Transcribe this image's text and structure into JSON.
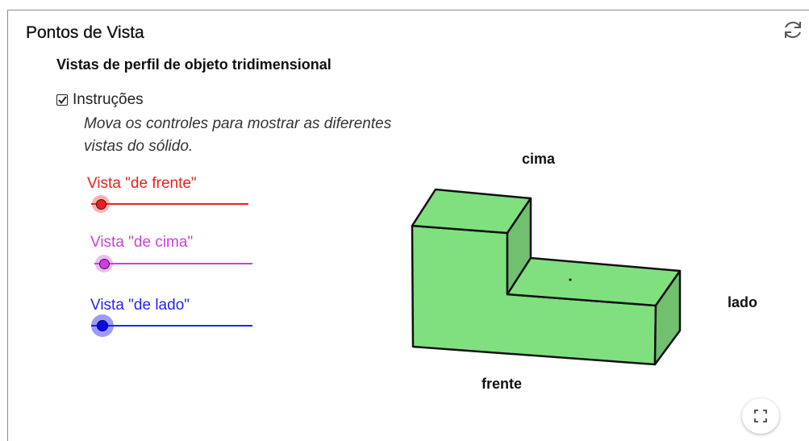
{
  "app": {
    "title": "Pontos de Vista",
    "subtitle": "Vistas de perfil de objeto tridimensional"
  },
  "toolbar": {
    "reset_icon": "refresh-icon",
    "fullscreen_icon": "fullscreen-icon"
  },
  "instructions": {
    "checkbox_label": "Instruções",
    "checked": true,
    "text_line1": "Mova os controles para mostrar as diferentes",
    "text_line2": "vistas do sólido."
  },
  "sliders": [
    {
      "label": "Vista \"de frente\"",
      "color": "#e8211f",
      "value": 0
    },
    {
      "label": "Vista \"de cima\"",
      "color": "#cc3fd9",
      "value": 0
    },
    {
      "label": "Vista \"de lado\"",
      "color": "#2424f0",
      "value": 0
    }
  ],
  "view_labels": {
    "top": "cima",
    "side": "lado",
    "front": "frente"
  },
  "colors": {
    "solid_fill": "#80e080",
    "solid_shade": "#70c070",
    "edge": "#111111"
  }
}
